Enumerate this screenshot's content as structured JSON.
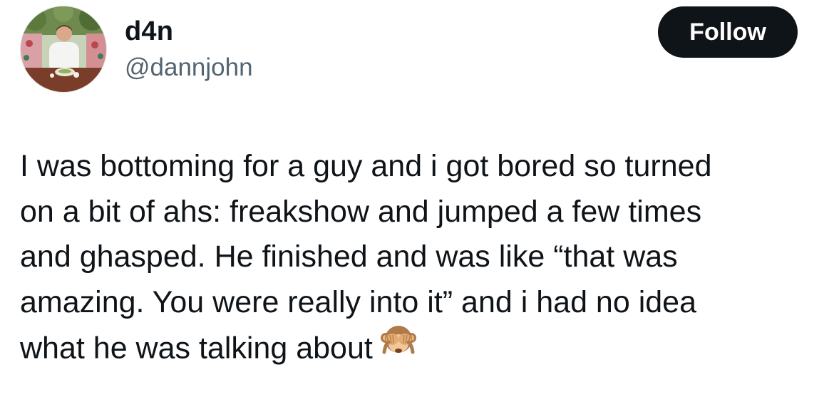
{
  "author": {
    "display_name": "d4n",
    "handle": "@dannjohn",
    "avatar_icon": "profile-photo"
  },
  "follow_button": {
    "label": "Follow",
    "bg_color": "#0f1419",
    "text_color": "#ffffff"
  },
  "tweet": {
    "lines": [
      "I was bottoming for a guy and i got bored so turned",
      "on a bit of ahs: freakshow and jumped a few times",
      "and ghasped. He finished and was like “that was",
      "amazing. You were really into it” and i had no idea",
      "what he was talking about"
    ],
    "emoji_icon": "see-no-evil-monkey"
  },
  "colors": {
    "text_primary": "#0f1419",
    "text_secondary": "#536471",
    "background": "#ffffff"
  }
}
